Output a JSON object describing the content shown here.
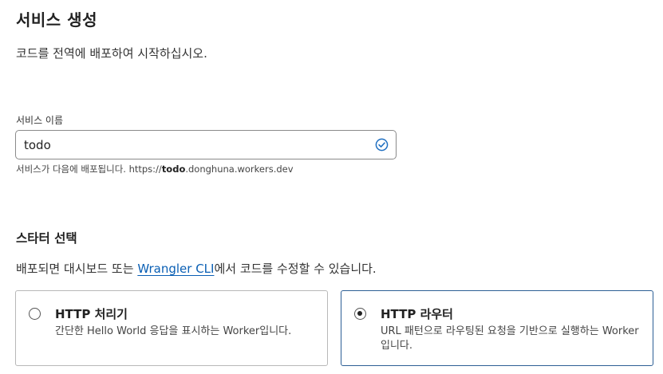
{
  "header": {
    "title": "서비스 생성",
    "subtitle": "코드를 전역에 배포하여 시작하십시오."
  },
  "service_name": {
    "label": "서비스 이름",
    "value": "todo",
    "status_icon": "check-circle-icon",
    "helper_prefix": "서비스가 다음에 배포됩니다. https://",
    "helper_name": "todo",
    "helper_suffix": ".donghuna.workers.dev"
  },
  "starter": {
    "title": "스타터 선택",
    "desc_prefix": "배포되면 대시보드 또는 ",
    "desc_link": "Wrangler CLI",
    "desc_suffix": "에서 코드를 수정할 수 있습니다.",
    "options": [
      {
        "title": "HTTP 처리기",
        "description": "간단한 Hello World 응답을 표시하는 Worker입니다.",
        "selected": false
      },
      {
        "title": "HTTP 라우터",
        "description": "URL 패턴으로 라우팅된 요청을 기반으로 실행하는 Worker입니다.",
        "selected": true
      }
    ]
  },
  "colors": {
    "link": "#0a5fb4",
    "selected_border": "#2d5f95",
    "check_icon": "#1f6fc1"
  }
}
